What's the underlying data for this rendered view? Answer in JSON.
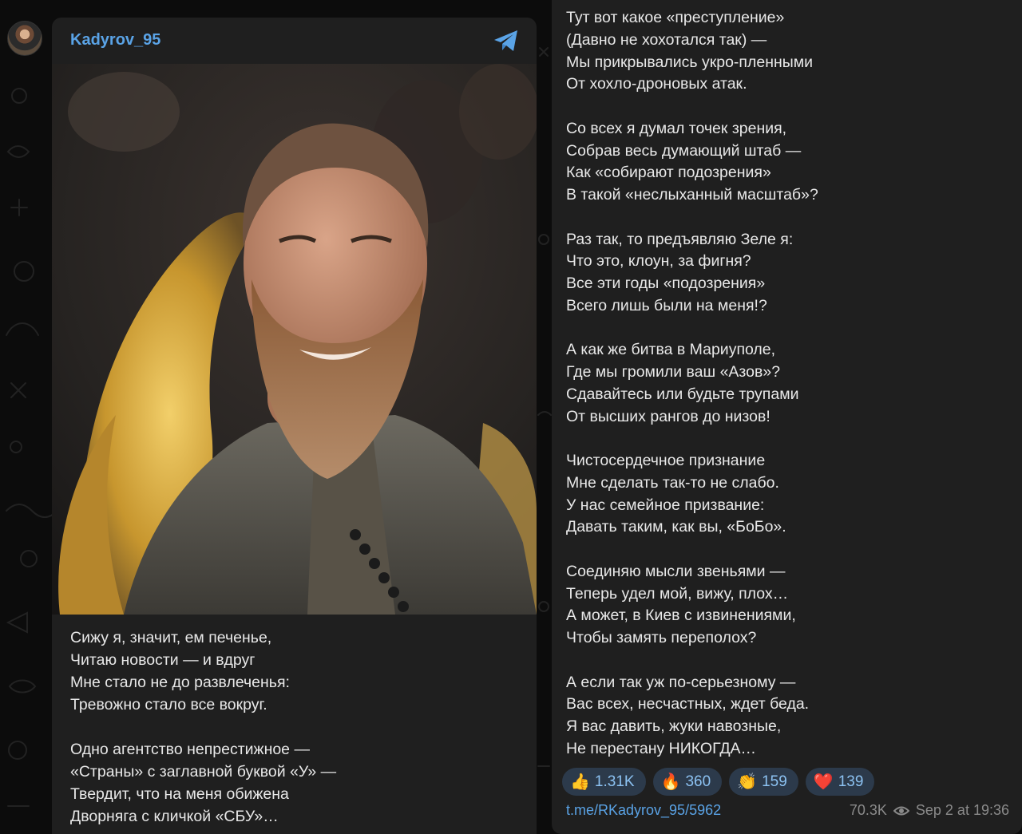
{
  "post": {
    "channel_name": "Kadyrov_95",
    "left_text": "Сижу я, значит, ем печенье,\nЧитаю новости — и вдруг\nМне стало не до развлеченья:\nТревожно стало все вокруг.\n\nОдно агентство непрестижное —\n«Страны» с заглавной буквой «У» —\nТвердит, что на меня обижена\nДворняга с кличкой «СБУ»…",
    "right_text": "Тут вот какое «преступление»\n(Давно не хохотался так) —\nМы прикрывались укро-пленными\nОт хохло-дроновых атак.\n\nСо всех я думал точек зрения,\nСобрав весь думающий штаб —\nКак «собирают подозрения»\nВ такой «неслыханный масштаб»?\n\nРаз так, то предъявляю Зеле я:\nЧто это, клоун, за фигня?\nВсе эти годы «подозрения»\nВсего лишь были на меня!?\n\nА как же битва в Мариуполе,\nГде мы громили ваш «Азов»?\nСдавайтесь или будьте трупами\nОт высших рангов до низов!\n\nЧистосердечное признание\nМне сделать так-то не слабо.\nУ нас семейное призвание:\nДавать таким, как вы, «БоБо».\n\nСоединяю мысли звеньями —\nТеперь удел мой, вижу, плох…\nА может, в Киев с извинениями,\nЧтобы замять переполох?\n\nА если так уж по-серьезному —\nВас всех, несчастных, ждет беда.\nЯ вас давить, жуки навозные,\nНе перестану НИКОГДА…",
    "reactions": [
      {
        "emoji": "👍",
        "count": "1.31K"
      },
      {
        "emoji": "🔥",
        "count": "360"
      },
      {
        "emoji": "👏",
        "count": "159"
      },
      {
        "emoji": "❤️",
        "count": "139"
      }
    ],
    "link": "t.me/RKadyrov_95/5962",
    "views": "70.3K",
    "date": "Sep 2 at 19:36"
  },
  "colors": {
    "accent": "#5aa3e6",
    "bubble": "#1f1f1f",
    "background": "#0c0c0c",
    "reaction_bg": "#2c3a4b"
  },
  "icons": {
    "telegram": "telegram-plane-icon",
    "views": "eye-icon"
  }
}
